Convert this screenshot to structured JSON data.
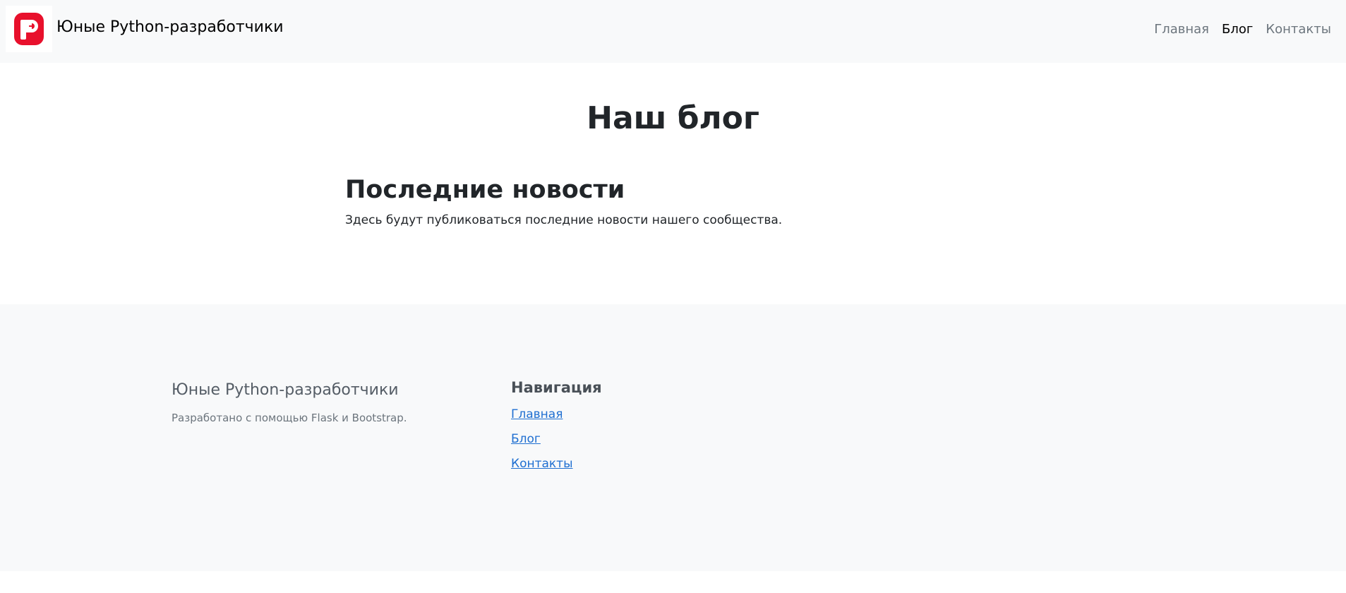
{
  "navbar": {
    "brand": "Юные Python-разработчики",
    "logo_color": "#e8102c",
    "links": [
      {
        "label": "Главная",
        "active": false
      },
      {
        "label": "Блог",
        "active": true
      },
      {
        "label": "Контакты",
        "active": false
      }
    ]
  },
  "main": {
    "title": "Наш блог",
    "section_heading": "Последние новости",
    "section_text": "Здесь будут публиковаться последние новости нашего сообщества."
  },
  "footer": {
    "brand": "Юные Python-разработчики",
    "credit": "Разработано с помощью Flask и Bootstrap.",
    "nav_title": "Навигация",
    "links": [
      {
        "label": "Главная"
      },
      {
        "label": "Блог"
      },
      {
        "label": "Контакты"
      }
    ]
  }
}
